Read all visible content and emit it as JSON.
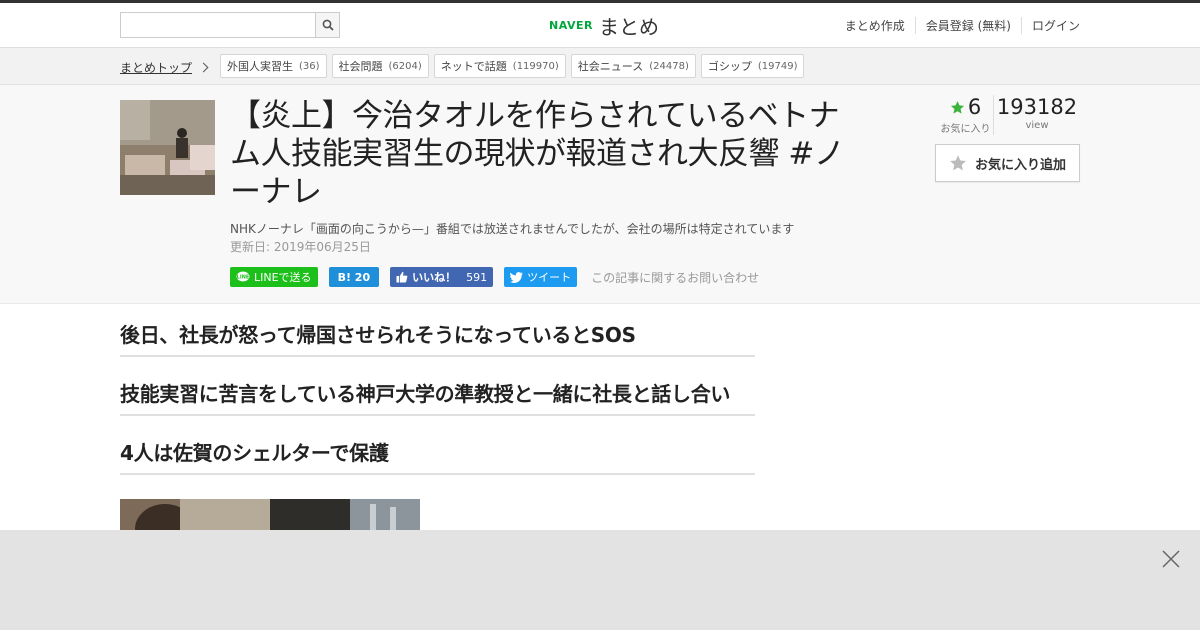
{
  "topbar": {
    "search": {
      "placeholder": "",
      "value": ""
    },
    "logo": {
      "brand": "NAVER",
      "name": "まとめ"
    },
    "links": [
      "まとめ作成",
      "会員登録 (無料)",
      "ログイン"
    ]
  },
  "breadcrumb": {
    "home": "まとめトップ",
    "tags": [
      {
        "label": "外国人実習生",
        "count": "(36)"
      },
      {
        "label": "社会問題",
        "count": "(6204)"
      },
      {
        "label": "ネットで話題",
        "count": "(119970)"
      },
      {
        "label": "社会ニュース",
        "count": "(24478)"
      },
      {
        "label": "ゴシップ",
        "count": "(19749)"
      }
    ]
  },
  "article": {
    "title": "【炎上】今治タオルを作らされているベトナム人技能実習生の現状が報道され大反響 #ノーナレ",
    "description": "NHKノーナレ「画面の向こうから—」番組では放送されませんでしたが、会社の場所は特定されています",
    "updated": "更新日: 2019年06月25日",
    "stats": {
      "favorites": "6",
      "favorites_label": "お気に入り",
      "views": "193182",
      "views_label": "view"
    },
    "fav_button": "お気に入り追加",
    "social": {
      "line": "LINEで送る",
      "hatena": "B! 20",
      "fb_label": "いいね！",
      "fb_count": "591",
      "tweet": "ツイート",
      "contact": "この記事に関するお問い合わせ"
    }
  },
  "sections": [
    "後日、社長が怒って帰国させられそうになっているとSOS",
    "技能実習に苦言をしている神戸大学の準教授と一緒に社長と話し合い",
    "4人は佐賀のシェルターで保護"
  ],
  "colors": {
    "accent_green": "#00a83c",
    "line": "#1dc01b",
    "hatena": "#1e8fd8",
    "facebook": "#4267b2",
    "twitter": "#1d9bf0",
    "star": "#3cb33c"
  }
}
